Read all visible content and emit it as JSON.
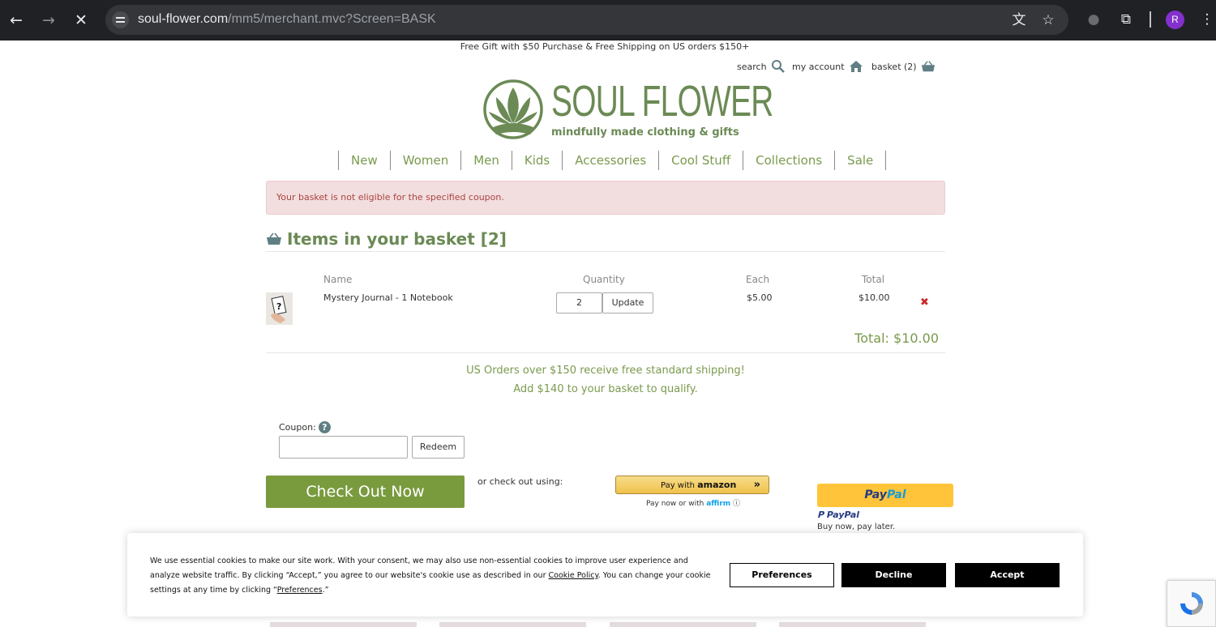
{
  "browser": {
    "url_host": "soul-flower.com",
    "url_path": "/mm5/merchant.mvc?Screen=BASK",
    "profile_initial": "R",
    "profile_color": "#8430ce"
  },
  "header": {
    "promo": "Free Gift with $50 Purchase & Free Shipping on US orders $150+",
    "search_label": "search",
    "account_label": "my account",
    "basket_label": "basket (2)"
  },
  "logo": {
    "name": "SOUL FLOWER",
    "tagline": "mindfully made clothing & gifts",
    "color": "#6b8a55"
  },
  "nav": {
    "items": [
      "New",
      "Women",
      "Men",
      "Kids",
      "Accessories",
      "Cool Stuff",
      "Collections",
      "Sale"
    ]
  },
  "alert": {
    "message": "Your basket is not eligible for the specified coupon."
  },
  "basket": {
    "heading": "Items in your basket [2]",
    "columns": {
      "name": "Name",
      "quantity": "Quantity",
      "each": "Each",
      "total": "Total"
    },
    "items": [
      {
        "name": "Mystery Journal - 1 Notebook",
        "quantity": "2",
        "update_label": "Update",
        "each": "$5.00",
        "total": "$10.00",
        "remove_symbol": "✖"
      }
    ],
    "grand_total": "Total: $10.00"
  },
  "shipping": {
    "line1": "US Orders over $150 receive free standard shipping!",
    "line2": "Add $140 to your basket to qualify."
  },
  "coupon": {
    "label": "Coupon:",
    "help_symbol": "?",
    "value": "",
    "redeem_label": "Redeem"
  },
  "checkout": {
    "checkout_label": "Check Out Now",
    "alt_label": "or check out using:",
    "amazon_prefix": "Pay with",
    "amazon_brand": "amazon",
    "amazon_arrows": "»",
    "affirm_text": "Pay now or with",
    "affirm_brand": "affirm",
    "paypal_btn_left": "Pay",
    "paypal_btn_right": "Pal",
    "paypal_logo": "PayPal",
    "paypal_later": "Buy now, pay later."
  },
  "cookie": {
    "text_part1": "We use essential cookies to make our site work. With your consent, we may also use non-essential cookies to improve user experience and analyze website traffic. By clicking “Accept,” you agree to our website's cookie use as described in our",
    "policy_link": "Cookie Policy",
    "text_part2": ". You can change your cookie settings at any time by clicking “",
    "preferences_link": "Preferences",
    "text_part3": ".”",
    "preferences_label": "Preferences",
    "decline_label": "Decline",
    "accept_label": "Accept"
  },
  "colors": {
    "brand_green": "#7a9a4e",
    "checkout_green": "#7a9a3e",
    "alert_bg": "#f2dede",
    "alert_text": "#a94442",
    "paypal_yellow": "#ffc439",
    "amazon_gold": "#f0c14b"
  },
  "icons": {
    "back": "arrow-left-icon",
    "forward": "arrow-right-icon",
    "stop": "close-icon",
    "translate": "translate-icon",
    "bookmark": "star-icon",
    "extensions": "puzzle-icon",
    "search": "magnifier-icon",
    "account": "house-icon",
    "basket": "basket-icon"
  }
}
